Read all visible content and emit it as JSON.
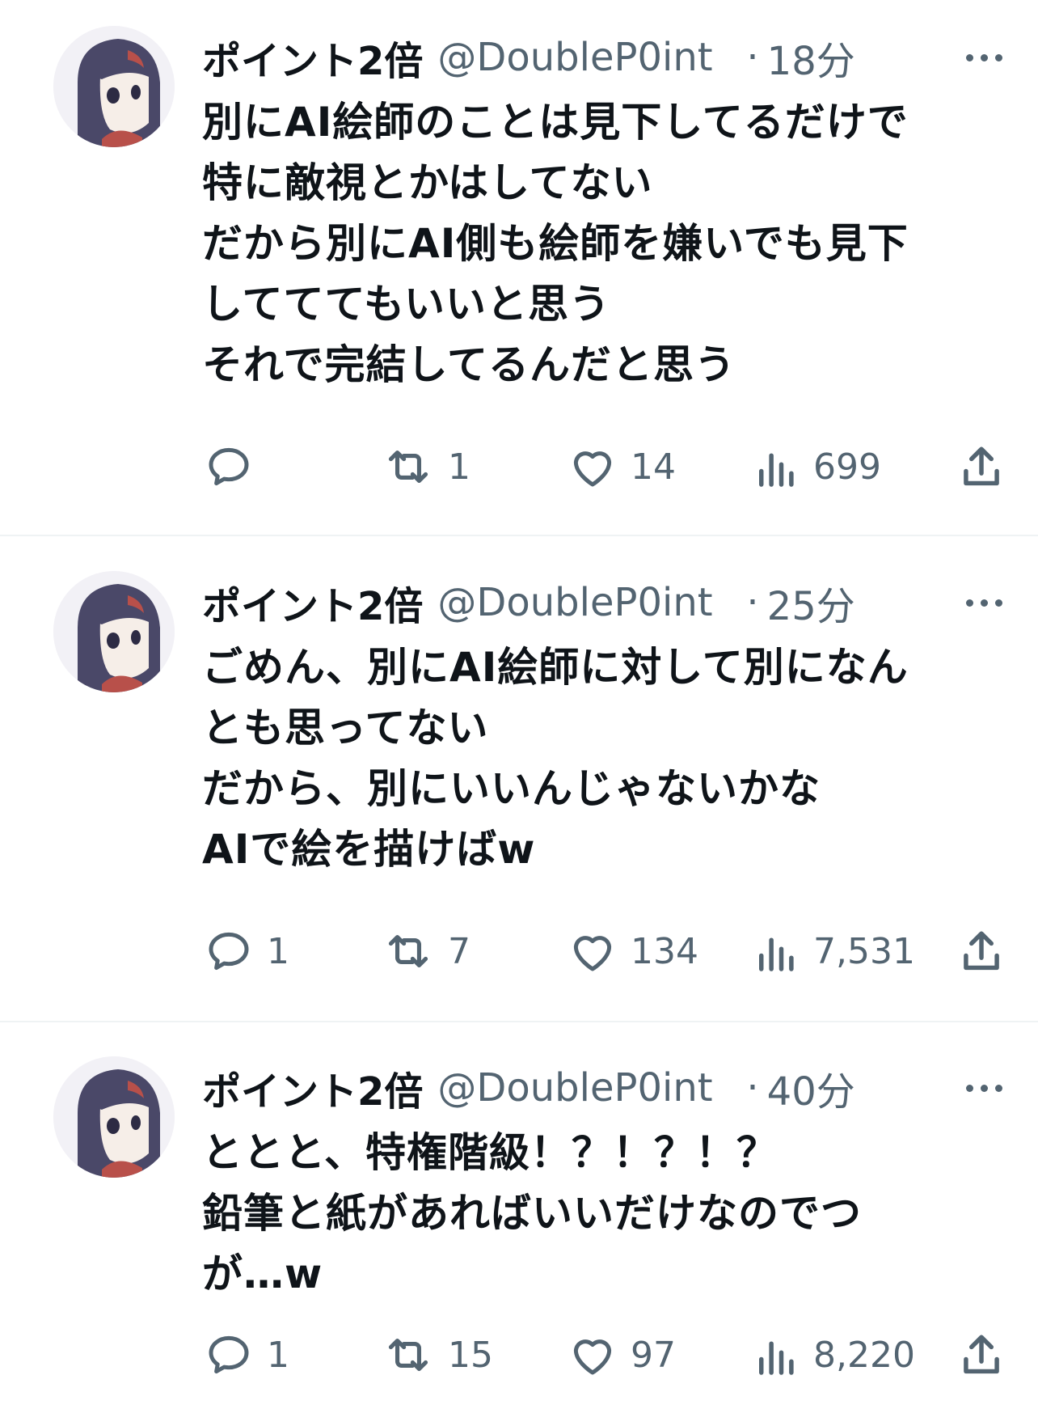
{
  "tweets": [
    {
      "name": "ポイント2倍",
      "handle": "@DoubleP0int",
      "dot": "·",
      "time": "18分",
      "lines": [
        "別にAI絵師のことは見下してるだけで",
        "特に敵視とかはしてない",
        "だから別にAI側も絵師を嫌いでも見下",
        "してててもいいと思う",
        "それで完結してるんだと思う"
      ],
      "stats": {
        "replies": "",
        "retweets": "1",
        "likes": "14",
        "views": "699"
      }
    },
    {
      "name": "ポイント2倍",
      "handle": "@DoubleP0int",
      "dot": "·",
      "time": "25分",
      "lines": [
        "ごめん、別にAI絵師に対して別になん",
        "とも思ってない",
        "だから、別にいいんじゃないかな",
        "AIで絵を描けばw"
      ],
      "stats": {
        "replies": "1",
        "retweets": "7",
        "likes": "134",
        "views": "7,531"
      }
    },
    {
      "name": "ポイント2倍",
      "handle": "@DoubleP0int",
      "dot": "·",
      "time": "40分",
      "lines": [
        "ととと、特権階級！？！？！？",
        "鉛筆と紙があればいいだけなのでつ",
        "が…w"
      ],
      "stats": {
        "replies": "1",
        "retweets": "15",
        "likes": "97",
        "views": "8,220"
      }
    }
  ],
  "icons": {
    "reply": "reply-icon",
    "retweet": "retweet-icon",
    "like": "heart-icon",
    "views": "views-icon",
    "share": "share-icon",
    "more": "more-icon"
  },
  "colors": {
    "text": "#0f1419",
    "secondary": "#536471",
    "divider": "#eff3f4",
    "avatar_hair": "#4a4868",
    "avatar_skin": "#f6eee8",
    "avatar_accent": "#b8504a"
  }
}
